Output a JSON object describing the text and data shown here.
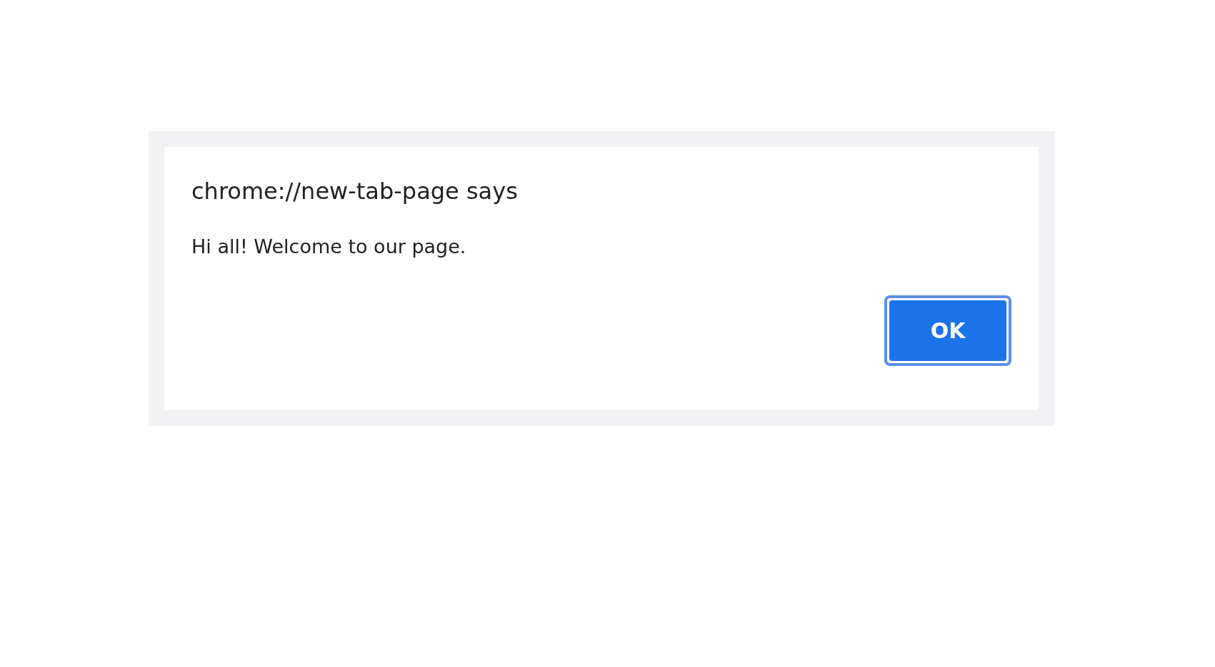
{
  "dialog": {
    "title": "chrome://new-tab-page says",
    "message": "Hi all! Welcome to our page.",
    "buttons": [
      "OK"
    ]
  }
}
